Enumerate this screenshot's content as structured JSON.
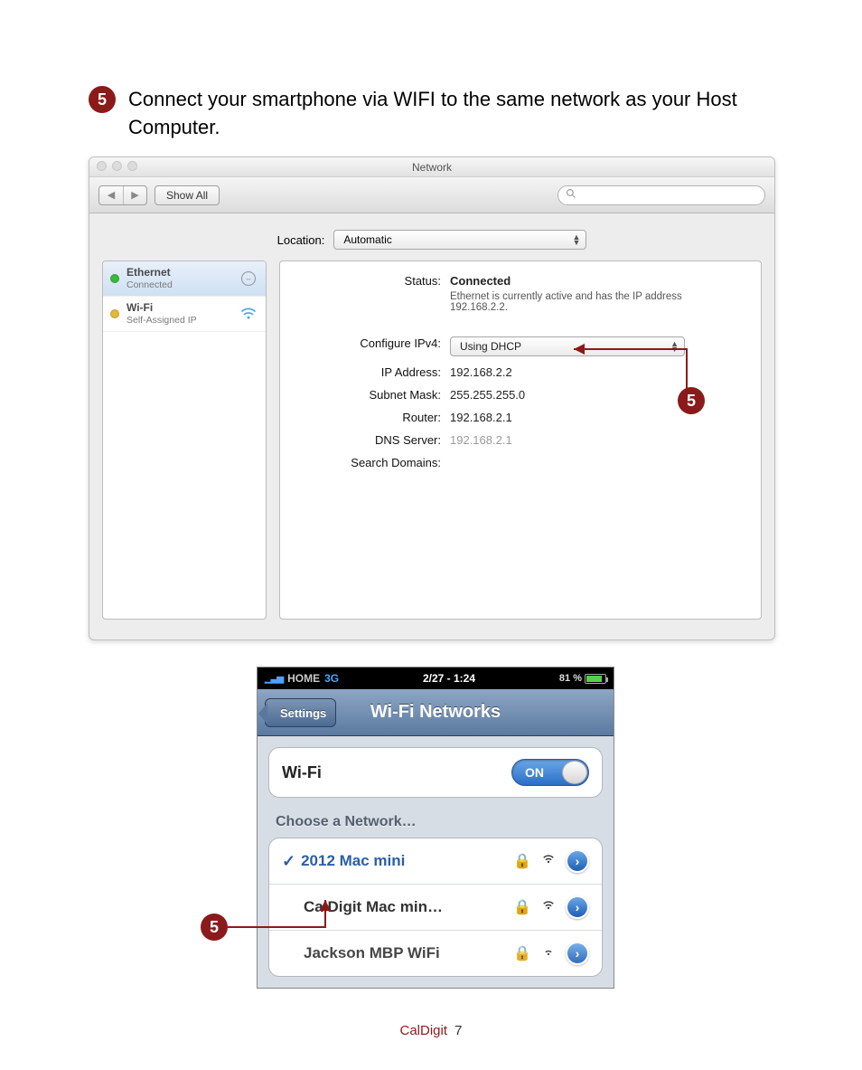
{
  "step": {
    "number": "5",
    "text": "Connect your smartphone via WIFI to the same network as your Host Computer."
  },
  "mac": {
    "title": "Network",
    "show_all": "Show All",
    "search_placeholder": "",
    "location_label": "Location:",
    "location_value": "Automatic",
    "sidebar": [
      {
        "title": "Ethernet",
        "sub": "Connected",
        "status": "green",
        "icon": "ethernet"
      },
      {
        "title": "Wi-Fi",
        "sub": "Self-Assigned IP",
        "status": "yellow",
        "icon": "wifi"
      }
    ],
    "detail": {
      "status_label": "Status:",
      "status_value": "Connected",
      "status_desc": "Ethernet is currently active and has the IP address 192.168.2.2.",
      "config_label": "Configure IPv4:",
      "config_value": "Using DHCP",
      "ip_label": "IP Address:",
      "ip_value": "192.168.2.2",
      "subnet_label": "Subnet Mask:",
      "subnet_value": "255.255.255.0",
      "router_label": "Router:",
      "router_value": "192.168.2.1",
      "dns_label": "DNS Server:",
      "dns_value": "192.168.2.1",
      "search_domains_label": "Search Domains:",
      "search_domains_value": ""
    }
  },
  "callout": {
    "a": "5",
    "b": "5"
  },
  "iphone": {
    "statusbar": {
      "carrier": "HOME",
      "network_type": "3G",
      "time": "2/27 - 1:24",
      "battery_pct": "81 %"
    },
    "navbar": {
      "back": "Settings",
      "title": "Wi-Fi Networks"
    },
    "wifi_row": {
      "label": "Wi-Fi",
      "toggle": "ON"
    },
    "choose_header": "Choose a Network…",
    "networks": [
      {
        "name": "2012 Mac mini",
        "selected": true,
        "locked": true
      },
      {
        "name": "CalDigit Mac min…",
        "selected": false,
        "locked": true
      },
      {
        "name": "Jackson MBP WiFi",
        "selected": false,
        "locked": true
      }
    ]
  },
  "footer": {
    "brand": "CalDigit",
    "page": "7"
  }
}
